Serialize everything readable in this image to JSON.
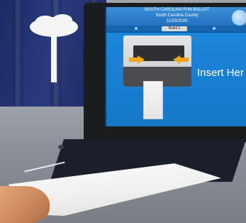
{
  "screen": {
    "header_lines": [
      "SOUTH CAROLINA FUN BALLOT",
      "South Carolina County",
      "11/03/2020"
    ],
    "status_bar_label": "Ballot 1",
    "instruction": "Insert Her"
  },
  "colors": {
    "screen_blue": "#1a82d6",
    "arrow_orange": "#f2a51a",
    "flag_navy": "#1d2a63"
  },
  "icons": [
    "palmetto-tree-icon",
    "arrow-right-icon",
    "arrow-left-icon",
    "ballot-paper-icon"
  ]
}
